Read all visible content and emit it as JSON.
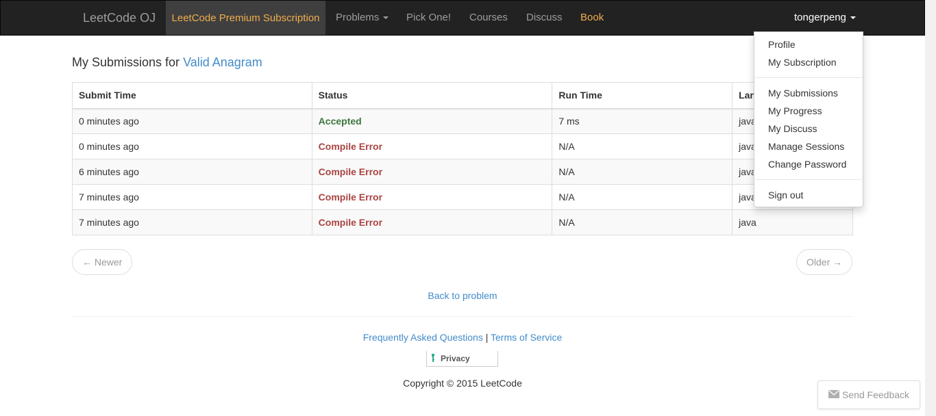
{
  "navbar": {
    "brand": "LeetCode OJ",
    "premium": "LeetCode Premium Subscription",
    "problems": "Problems",
    "pick_one": "Pick One!",
    "courses": "Courses",
    "discuss": "Discuss",
    "book": "Book",
    "user": "tongerpeng"
  },
  "heading": {
    "prefix": "My Submissions for",
    "problem": "Valid Anagram"
  },
  "table": {
    "headers": [
      "Submit Time",
      "Status",
      "Run Time",
      "Language"
    ],
    "rows": [
      {
        "time": "0 minutes ago",
        "status": "Accepted",
        "runtime": "7 ms",
        "lang": "java"
      },
      {
        "time": "0 minutes ago",
        "status": "Compile Error",
        "runtime": "N/A",
        "lang": "java"
      },
      {
        "time": "6 minutes ago",
        "status": "Compile Error",
        "runtime": "N/A",
        "lang": "java"
      },
      {
        "time": "7 minutes ago",
        "status": "Compile Error",
        "runtime": "N/A",
        "lang": "java"
      },
      {
        "time": "7 minutes ago",
        "status": "Compile Error",
        "runtime": "N/A",
        "lang": "java"
      }
    ]
  },
  "pager": {
    "newer": "← Newer",
    "older": "Older →"
  },
  "back_link": "Back to problem",
  "footer": {
    "faq": "Frequently Asked Questions",
    "separator": "|",
    "terms": "Terms of Service",
    "privacy": "Privacy",
    "copyright": "Copyright © 2015 LeetCode"
  },
  "feedback": {
    "label": "Send Feedback",
    "icon": "envelope-icon"
  },
  "dropdown": {
    "items": [
      "Profile",
      "My Subscription",
      "My Submissions",
      "My Progress",
      "My Discuss",
      "Manage Sessions",
      "Change Password",
      "Sign out"
    ]
  },
  "colors": {
    "navbar_bg": "#222222",
    "premium_text": "#f0ad4e",
    "link": "#428bca",
    "accepted": "#3c763d",
    "error": "#a94442"
  }
}
